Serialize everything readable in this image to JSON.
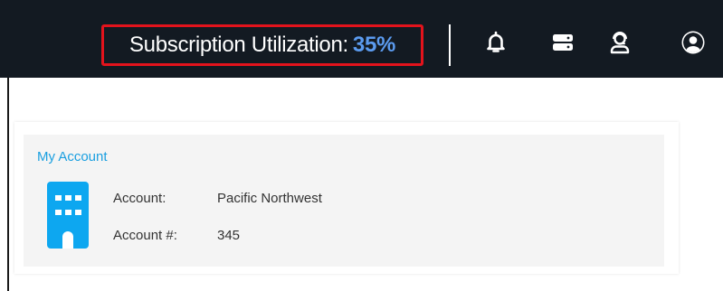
{
  "header": {
    "utilization_label": "Subscription Utilization:",
    "utilization_value": "35%",
    "icons": [
      "bell-icon",
      "server-icon",
      "support-agent-icon",
      "user-account-icon"
    ]
  },
  "account_card": {
    "title": "My Account",
    "icon": "building-icon",
    "account_label": "Account:",
    "account_value": "Pacific Northwest",
    "number_label": "Account #:",
    "number_value": "345"
  },
  "colors": {
    "topbar_bg": "#131a22",
    "highlight_border": "#e3131c",
    "utilization_value": "#5b9bef",
    "accent": "#0da7f0",
    "link": "#1a9fe0"
  }
}
